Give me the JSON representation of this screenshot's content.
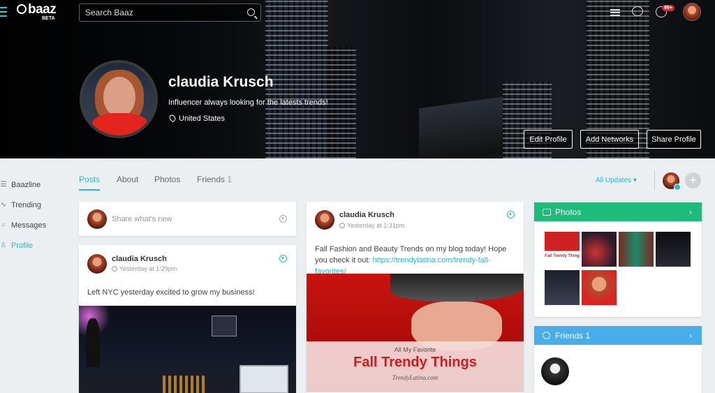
{
  "topbar": {
    "logo": "baaz",
    "beta": "BETA",
    "search_placeholder": "Search Baaz",
    "notification_badge": "99+"
  },
  "profile": {
    "name": "claudia Krusch",
    "bio": "Influencer always looking for the latests trends!",
    "location": "United States",
    "buttons": {
      "edit": "Edit Profile",
      "networks": "Add Networks",
      "share": "Share Profile"
    }
  },
  "sidebar": {
    "items": [
      {
        "label": "Baazline",
        "icon": "lines-icon"
      },
      {
        "label": "Trending",
        "icon": "trending-icon"
      },
      {
        "label": "Messages",
        "icon": "message-icon"
      },
      {
        "label": "Profile",
        "icon": "user-icon"
      }
    ]
  },
  "tabs": {
    "posts": "Posts",
    "about": "About",
    "photos": "Photos",
    "friends": "Friends",
    "friends_count": "1"
  },
  "updates_filter": "All Updates",
  "composer": {
    "placeholder": "Share what's new"
  },
  "posts": [
    {
      "author": "claudia Krusch",
      "time": "Yesterday at 1:29pm",
      "text": "Left NYC yesterday excited to grow my business!"
    },
    {
      "author": "claudia Krusch",
      "time": "Yesterday at 1:31pm",
      "text": "Fall Fashion and Beauty Trends on my blog today! Hope you check it out:",
      "link": "https://trendylatina.com/trendy-fall-favorites/",
      "image_text": {
        "line1": "All My Favorite",
        "line2": "Fall Trendy Things",
        "line3": "TrendyLatina.com"
      }
    }
  ],
  "photos_panel": {
    "title": "Photos",
    "thumb_caption": "Fall Trendy Thing"
  },
  "friends_panel": {
    "title": "Friends",
    "count": "1"
  },
  "colors": {
    "accent": "#2bb8c6",
    "photos_header": "#1fbb7a",
    "friends_header": "#47aee9",
    "badge": "#e0243a"
  }
}
